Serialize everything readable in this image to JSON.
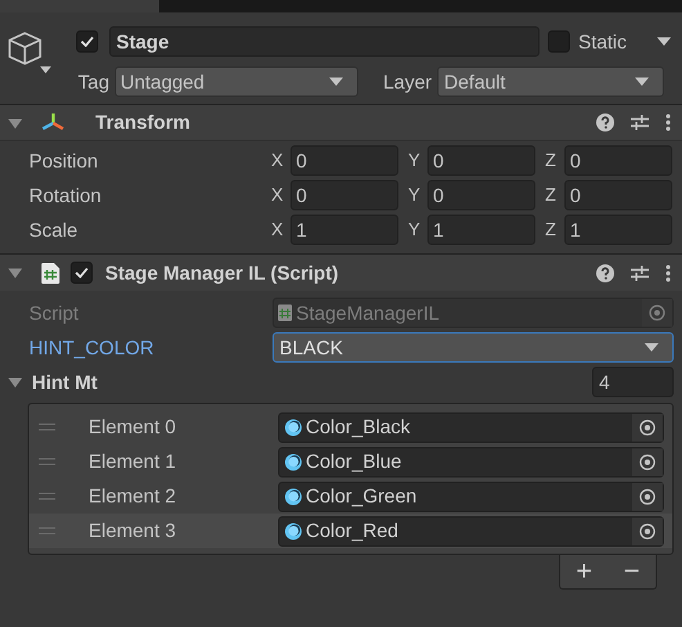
{
  "game_object": {
    "active": true,
    "name": "Stage",
    "static_label": "Static",
    "static": false,
    "tag_label": "Tag",
    "tag": "Untagged",
    "layer_label": "Layer",
    "layer": "Default"
  },
  "transform": {
    "title": "Transform",
    "expanded": true,
    "rows": [
      {
        "label": "Position",
        "axes": [
          {
            "axis": "X",
            "value": "0"
          },
          {
            "axis": "Y",
            "value": "0"
          },
          {
            "axis": "Z",
            "value": "0"
          }
        ]
      },
      {
        "label": "Rotation",
        "axes": [
          {
            "axis": "X",
            "value": "0"
          },
          {
            "axis": "Y",
            "value": "0"
          },
          {
            "axis": "Z",
            "value": "0"
          }
        ]
      },
      {
        "label": "Scale",
        "axes": [
          {
            "axis": "X",
            "value": "1"
          },
          {
            "axis": "Y",
            "value": "1"
          },
          {
            "axis": "Z",
            "value": "1"
          }
        ]
      }
    ]
  },
  "script_component": {
    "title": "Stage Manager IL (Script)",
    "enabled": true,
    "expanded": true,
    "script_label": "Script",
    "script_value": "StageManagerIL",
    "hint_color_label": "HINT_COLOR",
    "hint_color_value": "BLACK",
    "hint_color_focused": true,
    "list_label": "Hint Mt",
    "list_expanded": true,
    "list_size": "4",
    "elements": [
      {
        "label": "Element 0",
        "value": "Color_Black",
        "selected": false
      },
      {
        "label": "Element 1",
        "value": "Color_Blue",
        "selected": false
      },
      {
        "label": "Element 2",
        "value": "Color_Green",
        "selected": false
      },
      {
        "label": "Element 3",
        "value": "Color_Red",
        "selected": true
      }
    ],
    "add_button": "+",
    "remove_button": "−"
  }
}
